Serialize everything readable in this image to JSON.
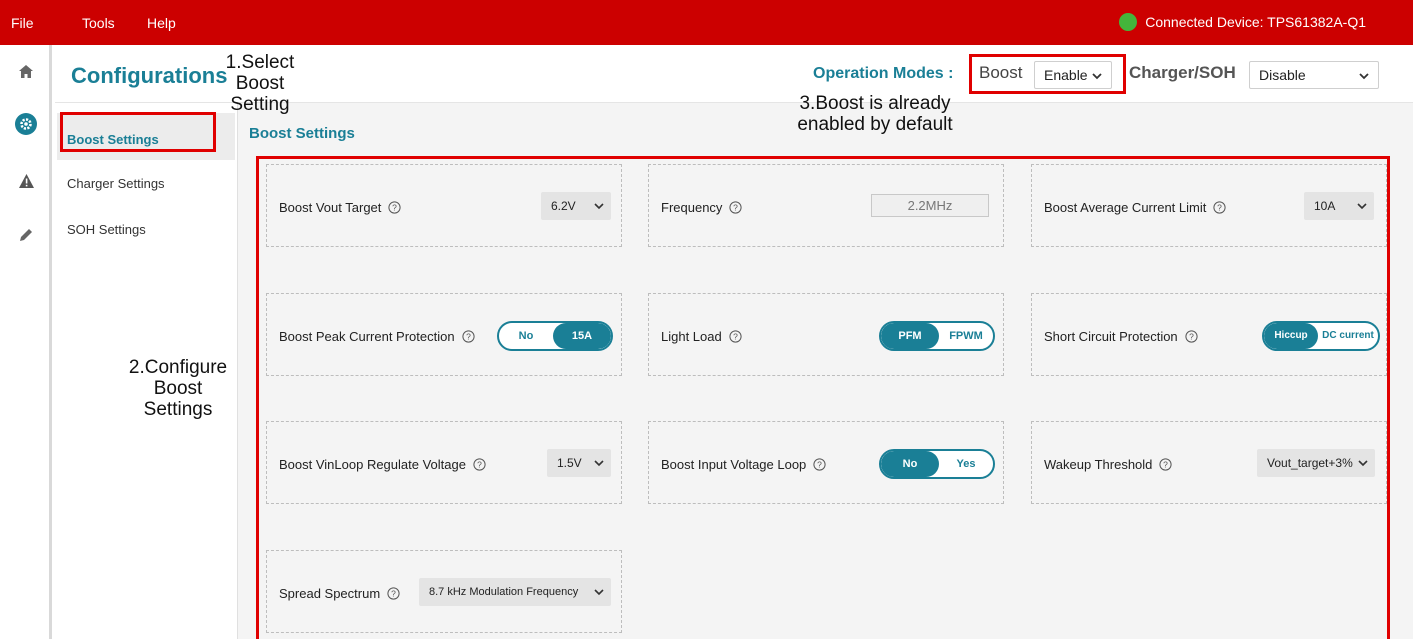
{
  "menu": {
    "file": "File",
    "tools": "Tools",
    "help": "Help"
  },
  "connection": {
    "label": "Connected Device: TPS61382A-Q1",
    "status_color": "#44b53b"
  },
  "header": {
    "title": "Configurations",
    "operation_modes_label": "Operation Modes :",
    "boost_label": "Boost",
    "boost_value": "Enable",
    "charger_label": "Charger/SOH",
    "charger_value": "Disable"
  },
  "subnav": {
    "items": [
      {
        "label": "Boost Settings"
      },
      {
        "label": "Charger Settings"
      },
      {
        "label": "SOH Settings"
      }
    ]
  },
  "section": {
    "title": "Boost Settings"
  },
  "settings": {
    "vout_target": {
      "label": "Boost Vout Target",
      "value": "6.2V"
    },
    "frequency": {
      "label": "Frequency",
      "value": "2.2MHz"
    },
    "avg_current_limit": {
      "label": "Boost Average Current Limit",
      "value": "10A"
    },
    "peak_current": {
      "label": "Boost Peak Current Protection",
      "options": [
        "No",
        "15A"
      ]
    },
    "light_load": {
      "label": "Light Load",
      "options": [
        "PFM",
        "FPWM"
      ]
    },
    "short_circuit": {
      "label": "Short Circuit Protection",
      "options": [
        "Hiccup",
        "DC current"
      ]
    },
    "vinloop": {
      "label": "Boost VinLoop Regulate Voltage",
      "value": "1.5V"
    },
    "input_voltage_loop": {
      "label": "Boost Input Voltage Loop",
      "options": [
        "No",
        "Yes"
      ]
    },
    "wakeup_threshold": {
      "label": "Wakeup Threshold",
      "value": "Vout_target+3%"
    },
    "spread_spectrum": {
      "label": "Spread Spectrum",
      "value": "8.7 kHz Modulation Frequency"
    }
  },
  "annotations": {
    "step1": [
      "1.Select",
      "Boost",
      "Setting"
    ],
    "step2": [
      "2.Configure",
      "Boost",
      "Settings"
    ],
    "step3": [
      "3.Boost is already",
      "enabled by default"
    ]
  },
  "colors": {
    "brand_red": "#cc0000",
    "accent_teal": "#1a7f96",
    "annotation_red": "#e00000"
  }
}
